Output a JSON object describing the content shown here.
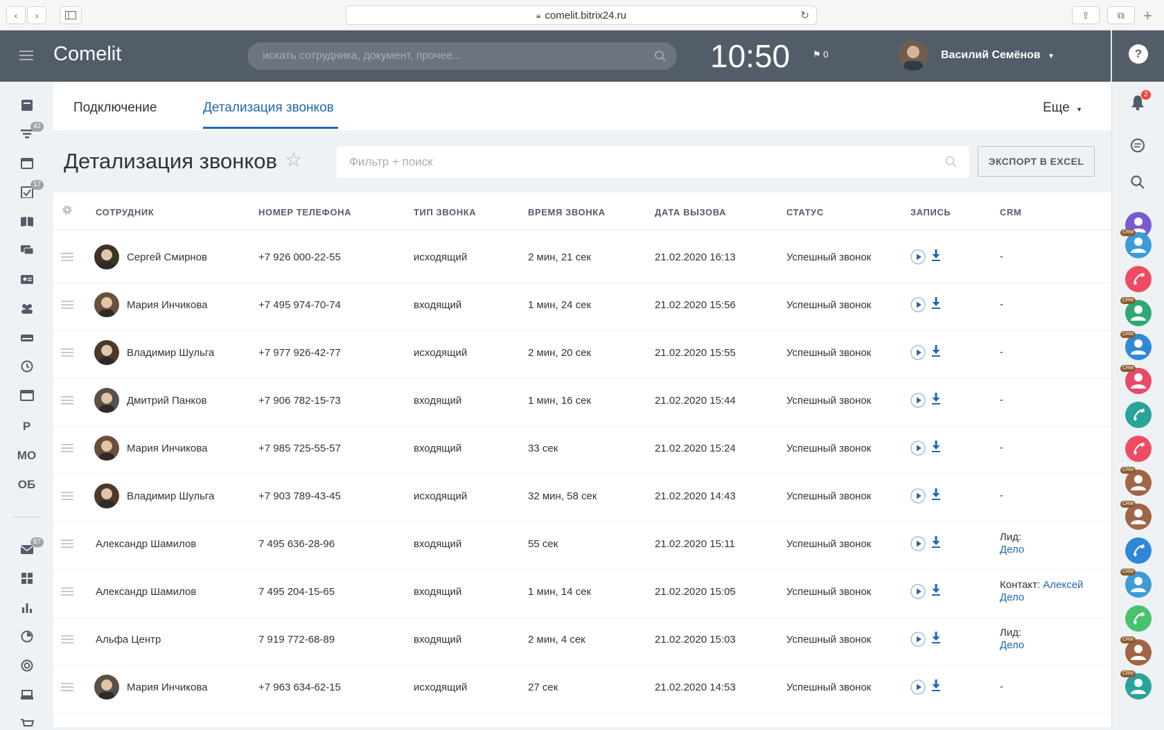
{
  "browser": {
    "url": "comelit.bitrix24.ru"
  },
  "header": {
    "logo": "Comelit",
    "search_placeholder": "искать сотрудника, документ, прочее...",
    "clock": "10:50",
    "flag_count": "0",
    "user_name": "Василий Семёнов"
  },
  "sidebar": {
    "badges": {
      "feed": "42",
      "tasks": "17",
      "mail": "87"
    },
    "text_items": [
      "Р",
      "МО",
      "ОБ"
    ]
  },
  "rightbar": {
    "notifications_count": "2",
    "crm_tag": "CRM"
  },
  "tabs": {
    "connection": "Подключение",
    "details": "Детализация звонков",
    "more": "Еще"
  },
  "page": {
    "title": "Детализация звонков",
    "filter_placeholder": "Фильтр + поиск",
    "export_label": "ЭКСПОРТ В EXCEL"
  },
  "table": {
    "headers": [
      "СОТРУДНИК",
      "НОМЕР ТЕЛЕФОНА",
      "ТИП ЗВОНКА",
      "ВРЕМЯ ЗВОНКА",
      "ДАТА ВЫЗОВА",
      "СТАТУС",
      "ЗАПИСЬ",
      "CRM"
    ],
    "rows": [
      {
        "employee": "Сергей Смирнов",
        "phone": "+7 926 000-22-55",
        "type": "исходящий",
        "duration": "2 мин, 21 сек",
        "date": "21.02.2020 16:13",
        "status": "Успешный звонок",
        "crm_text": "-",
        "crm_link": "",
        "crm_link2": ""
      },
      {
        "employee": "Мария Инчикова",
        "phone": "+7 495 974-70-74",
        "type": "входящий",
        "duration": "1 мин, 24 сек",
        "date": "21.02.2020 15:56",
        "status": "Успешный звонок",
        "crm_text": "-",
        "crm_link": "",
        "crm_link2": ""
      },
      {
        "employee": "Владимир Шульга",
        "phone": "+7 977 926-42-77",
        "type": "исходящий",
        "duration": "2 мин, 20 сек",
        "date": "21.02.2020 15:55",
        "status": "Успешный звонок",
        "crm_text": "-",
        "crm_link": "",
        "crm_link2": ""
      },
      {
        "employee": "Дмитрий Панков",
        "phone": "+7 906 782-15-73",
        "type": "входящий",
        "duration": "1 мин, 16 сек",
        "date": "21.02.2020 15:44",
        "status": "Успешный звонок",
        "crm_text": "-",
        "crm_link": "",
        "crm_link2": ""
      },
      {
        "employee": "Мария Инчикова",
        "phone": "+7 985 725-55-57",
        "type": "входящий",
        "duration": "33 сек",
        "date": "21.02.2020 15:24",
        "status": "Успешный звонок",
        "crm_text": "-",
        "crm_link": "",
        "crm_link2": ""
      },
      {
        "employee": "Владимир Шульга",
        "phone": "+7 903 789-43-45",
        "type": "исходящий",
        "duration": "32 мин, 58 сек",
        "date": "21.02.2020 14:43",
        "status": "Успешный звонок",
        "crm_text": "-",
        "crm_link": "",
        "crm_link2": ""
      },
      {
        "employee": "Александр Шамилов",
        "phone": "7 495 636-28-96",
        "type": "входящий",
        "duration": "55 сек",
        "date": "21.02.2020 15:11",
        "status": "Успешный звонок",
        "crm_text": "Лид:",
        "crm_link": "",
        "crm_link2": "Дело"
      },
      {
        "employee": "Александр Шамилов",
        "phone": "7 495 204-15-65",
        "type": "входящий",
        "duration": "1 мин, 14 сек",
        "date": "21.02.2020 15:05",
        "status": "Успешный звонок",
        "crm_text": "Контакт:",
        "crm_link": "Алексей",
        "crm_link2": "Дело"
      },
      {
        "employee": "Альфа Центр",
        "phone": "7 919 772-68-89",
        "type": "входящий",
        "duration": "2 мин, 4 сек",
        "date": "21.02.2020 15:03",
        "status": "Успешный звонок",
        "crm_text": "Лид:",
        "crm_link": "",
        "crm_link2": "Дело"
      },
      {
        "employee": "Мария Инчикова",
        "phone": "+7 963 634-62-15",
        "type": "исходящий",
        "duration": "27 сек",
        "date": "21.02.2020 14:53",
        "status": "Успешный звонок",
        "crm_text": "-",
        "crm_link": "",
        "crm_link2": ""
      }
    ]
  },
  "colors": {
    "header_bg": "#535c69",
    "accent": "#2067b0",
    "page_bg": "#eef2f4"
  }
}
